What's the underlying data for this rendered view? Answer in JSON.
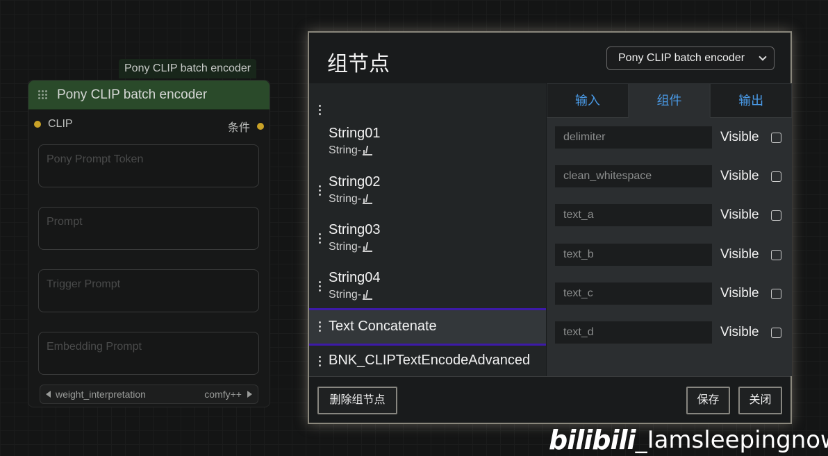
{
  "node": {
    "title_tag": "Pony CLIP batch encoder",
    "title": "Pony CLIP batch encoder",
    "input_slot": "CLIP",
    "output_slot": "条件",
    "text_widgets": [
      "Pony Prompt Token",
      "Prompt",
      "Trigger Prompt",
      "Embedding Prompt"
    ],
    "combo": {
      "label": "weight_interpretation",
      "value": "comfy++"
    },
    "slot_color": "#c9a227"
  },
  "dialog": {
    "title": "组节点",
    "selected_group": "Pony CLIP batch encoder",
    "nodes": [
      {
        "name": "String01",
        "sub": "String-"
      },
      {
        "name": "String02",
        "sub": "String-"
      },
      {
        "name": "String03",
        "sub": "String-"
      },
      {
        "name": "String04",
        "sub": "String-"
      },
      {
        "name": "Text Concatenate"
      },
      {
        "name": "BNK_CLIPTextEncodeAdvanced"
      }
    ],
    "tabs": [
      "输入",
      "组件",
      "输出"
    ],
    "active_tab": "组件",
    "widgets": [
      "delimiter",
      "clean_whitespace",
      "text_a",
      "text_b",
      "text_c",
      "text_d"
    ],
    "visible_label": "Visible",
    "buttons": {
      "delete": "删除组节点",
      "save": "保存",
      "close": "关闭"
    },
    "accent_color": "#3d1aa8",
    "tab_text_color": "#4a9be8"
  },
  "watermark": {
    "logo": "bilibili",
    "user": "_Iamsleepingnow"
  }
}
